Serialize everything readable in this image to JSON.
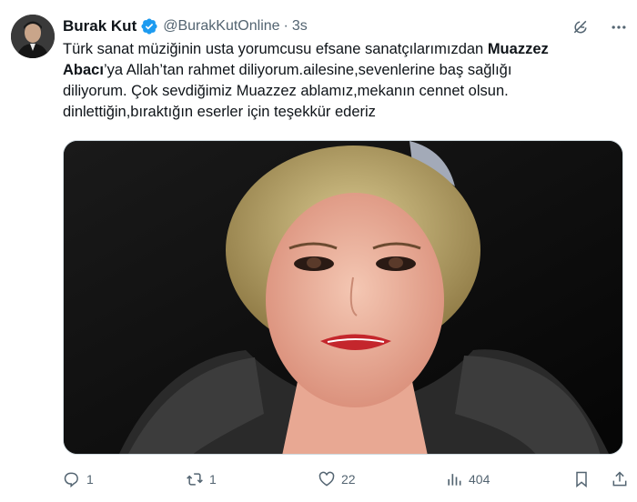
{
  "author": {
    "name": "Burak Kut",
    "handle": "@BurakKutOnline",
    "separator": "·",
    "time": "3s",
    "verified_color": "#1d9bf0"
  },
  "tweet": {
    "line1_prefix": "Türk sanat müziğinin usta yorumcusu efsane sanatçılarımızdan ",
    "line1_bold": "Muazzez",
    "line2_bold": "Abacı",
    "line2_rest": "’ya Allah’tan rahmet diliyorum.ailesine,sevenlerine baş sağlığı",
    "line3": "diliyorum. Çok sevdiğimiz Muazzez ablamız,mekanın cennet olsun.",
    "line4": "dinlettiğin,bıraktığın eserler için teşekkür ederiz"
  },
  "actions": {
    "replies": "1",
    "retweets": "1",
    "likes": "22",
    "views": "404"
  },
  "icons": [
    "verified-badge-icon",
    "grok-icon",
    "more-icon",
    "reply-icon",
    "retweet-icon",
    "like-icon",
    "views-icon",
    "bookmark-icon",
    "share-icon"
  ]
}
